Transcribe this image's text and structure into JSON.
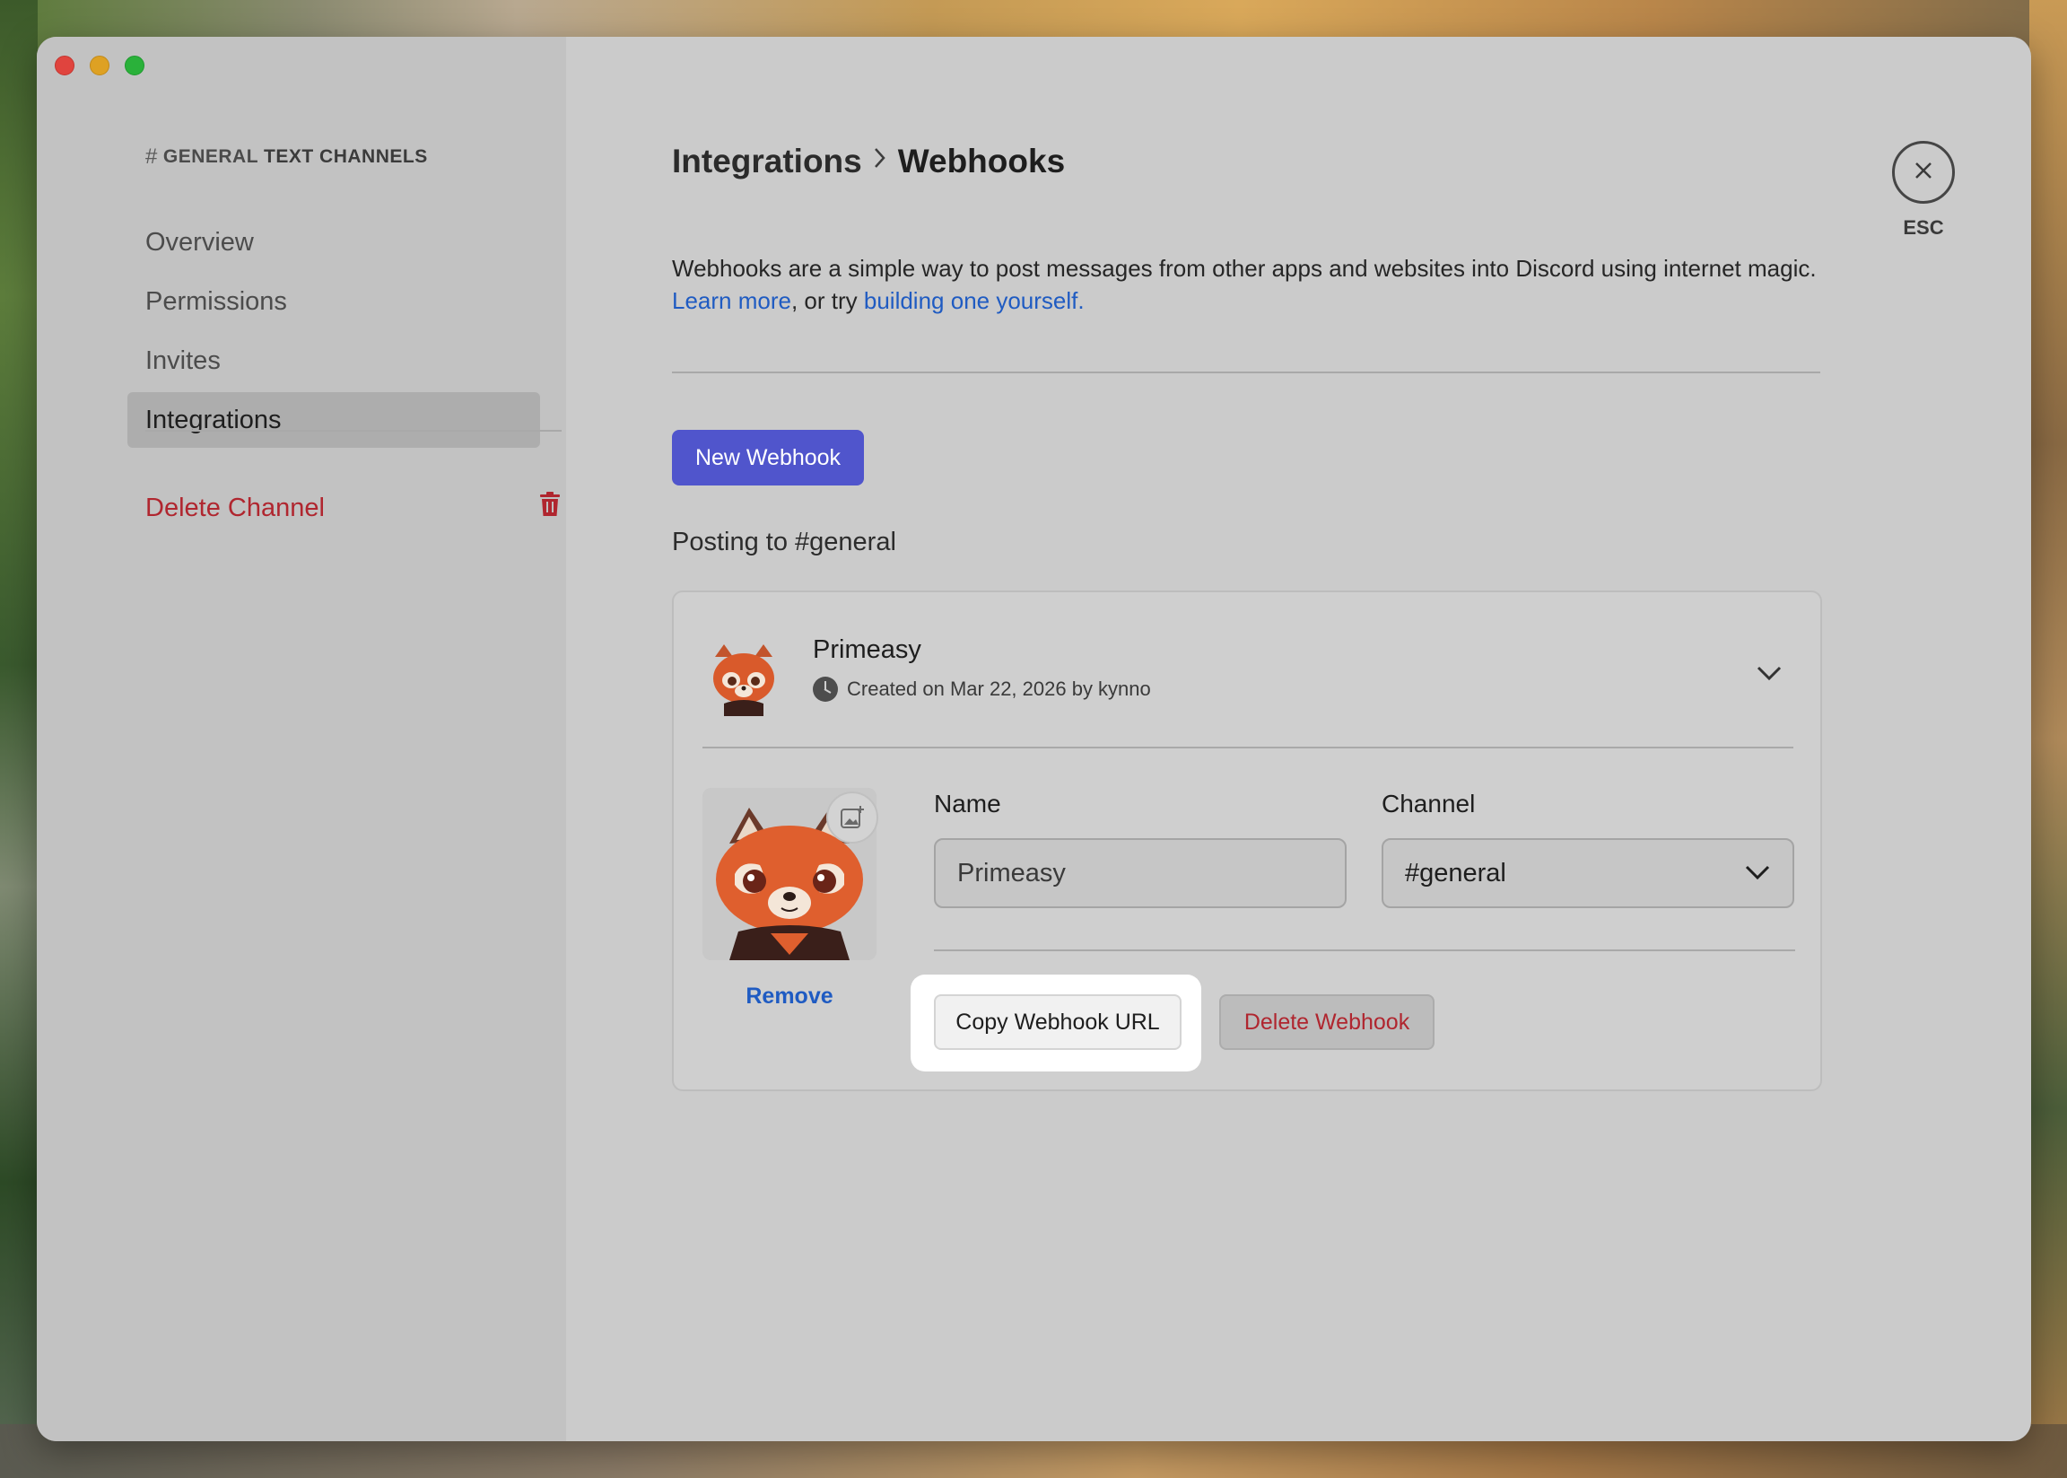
{
  "sidebar": {
    "header_channel": "GENERAL",
    "header_category": "TEXT CHANNELS",
    "items": [
      {
        "label": "Overview"
      },
      {
        "label": "Permissions"
      },
      {
        "label": "Invites"
      },
      {
        "label": "Integrations",
        "active": true
      }
    ],
    "delete_channel_label": "Delete Channel"
  },
  "header": {
    "crumb1": "Integrations",
    "crumb2": "Webhooks",
    "esc_label": "ESC"
  },
  "description": {
    "text": "Webhooks are a simple way to post messages from other apps and websites into Discord using internet magic.",
    "learn_more": "Learn more",
    "or_try": ", or try ",
    "build_link": "building one yourself."
  },
  "actions": {
    "new_webhook": "New Webhook"
  },
  "posting": {
    "label": "Posting to #general"
  },
  "webhook": {
    "name": "Primeasy",
    "meta": "Created on Mar 22, 2026 by kynno",
    "remove_label": "Remove",
    "name_label": "Name",
    "name_value": "Primeasy",
    "channel_label": "Channel",
    "channel_value": "#general",
    "copy_label": "Copy Webhook URL",
    "delete_label": "Delete Webhook"
  },
  "colors": {
    "accent": "#5055cc",
    "link": "#1f5bc2",
    "danger": "#b0262f"
  }
}
